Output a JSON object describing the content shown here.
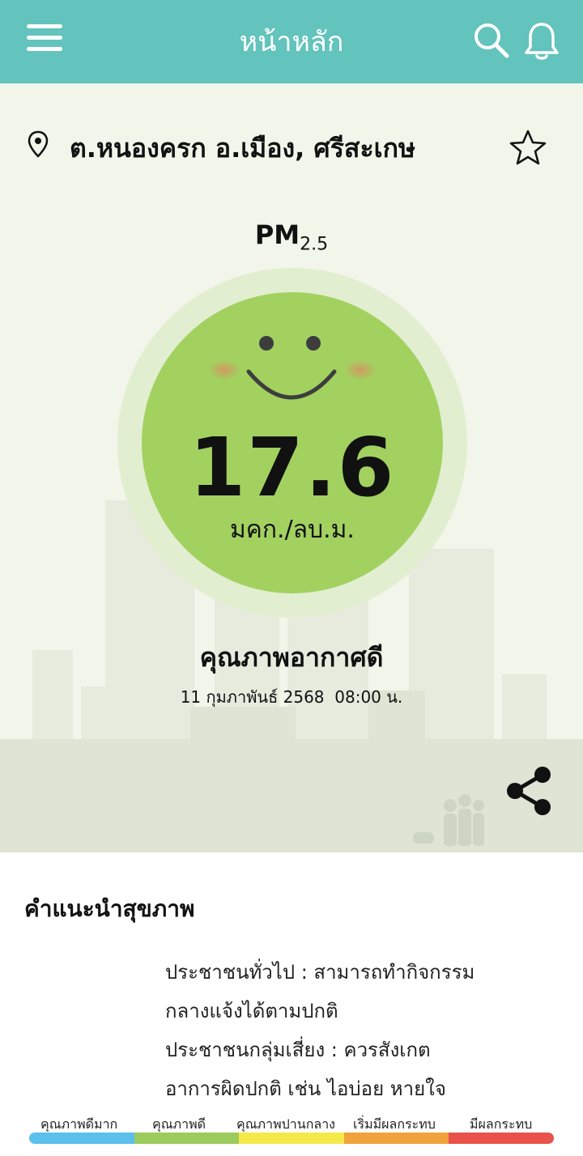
{
  "header": {
    "title": "หน้าหลัก",
    "menu_icon": "menu-icon",
    "search_icon": "search-icon",
    "bell_icon": "bell-icon",
    "background_color": "#63c3bd"
  },
  "location": {
    "name": "ต.หนองครก อ.เมือง, ศรีสะเกษ",
    "pin_icon": "location-pin-icon",
    "favorite_icon": "star-icon"
  },
  "pm": {
    "label": "PM",
    "subscript": "2.5",
    "value": "17.6",
    "unit": "มคก./ลบ.ม.",
    "quality": "คุณภาพอากาศดี",
    "datetime": "11 กุมภาพันธ์ 2568  08:00 น.",
    "color": "#a2d160",
    "face_icon": "smiley-face-icon"
  },
  "share": {
    "icon": "share-icon"
  },
  "advice": {
    "title": "คำแนะนำสุขภาพ",
    "lines": [
      "ประชาชนทั่วไป : สามารถทำกิจกรรม",
      "กลางแจ้งได้ตามปกติ",
      "ประชาชนกลุ่มเสี่ยง : ควรสังเกต",
      "อาการผิดปกติ เช่น ไอบ่อย หายใจ"
    ]
  },
  "legend": {
    "items": [
      {
        "label": "คุณภาพดีมาก",
        "color": "#5bc0eb"
      },
      {
        "label": "คุณภาพดี",
        "color": "#9ccc5c"
      },
      {
        "label": "คุณภาพปานกลาง",
        "color": "#f5e94a"
      },
      {
        "label": "เริ่มมีผลกระทบ",
        "color": "#f0a33a"
      },
      {
        "label": "มีผลกระทบ",
        "color": "#e8524a"
      }
    ]
  }
}
